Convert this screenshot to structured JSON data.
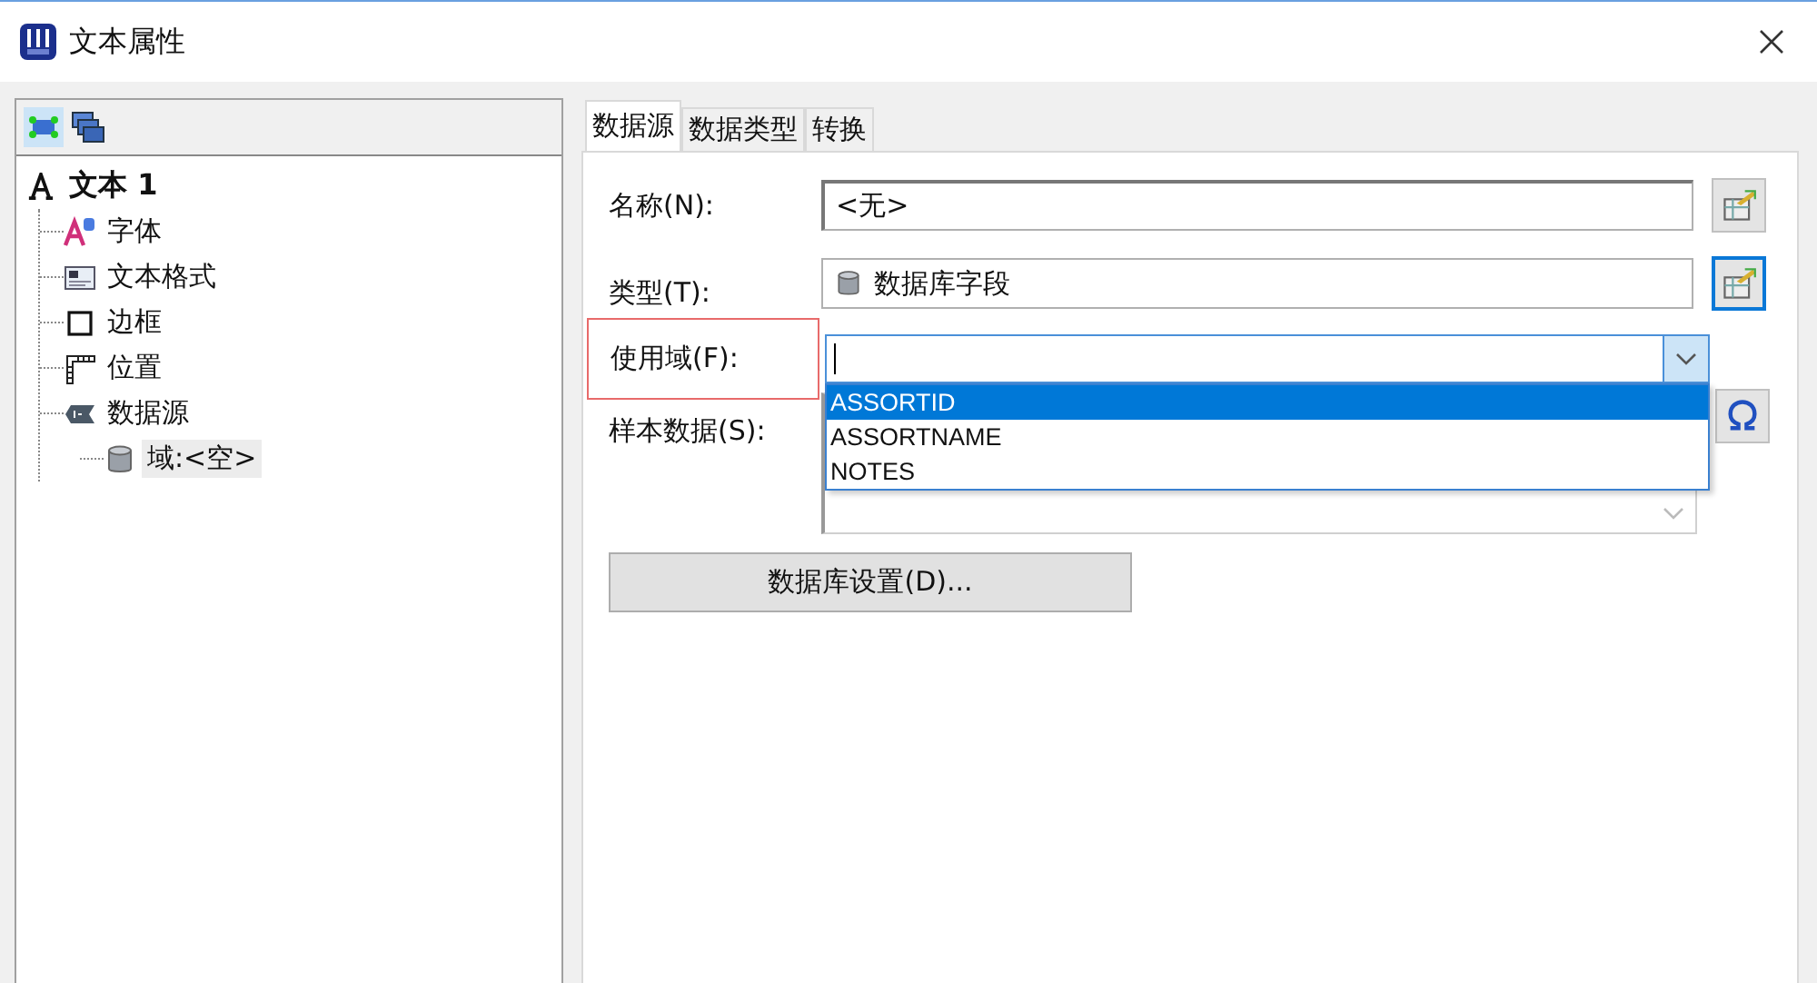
{
  "window": {
    "title": "文本属性"
  },
  "tree": {
    "label": "文本 1",
    "children": [
      {
        "label": "字体",
        "kind": "font",
        "selected": false
      },
      {
        "label": "文本格式",
        "kind": "format",
        "selected": false
      },
      {
        "label": "边框",
        "kind": "border",
        "selected": false
      },
      {
        "label": "位置",
        "kind": "position",
        "selected": false
      },
      {
        "label": "数据源",
        "kind": "datasource",
        "selected": false,
        "children": [
          {
            "label": "域:<空>",
            "selected": true
          }
        ]
      }
    ]
  },
  "tabs": [
    {
      "label": "数据源",
      "selected": true
    },
    {
      "label": "数据类型",
      "selected": false
    },
    {
      "label": "转换",
      "selected": false
    }
  ],
  "form": {
    "name_label": "名称(N):",
    "name_value": "<无>",
    "type_label": "类型(T):",
    "type_value": "数据库字段",
    "field_label": "使用域(F):",
    "field_options": [
      {
        "label": "ASSORTID",
        "selected": true
      },
      {
        "label": "ASSORTNAME",
        "selected": false
      },
      {
        "label": "NOTES",
        "selected": false
      }
    ],
    "sample_label": "样本数据(S):",
    "db_button": "数据库设置(D)..."
  }
}
